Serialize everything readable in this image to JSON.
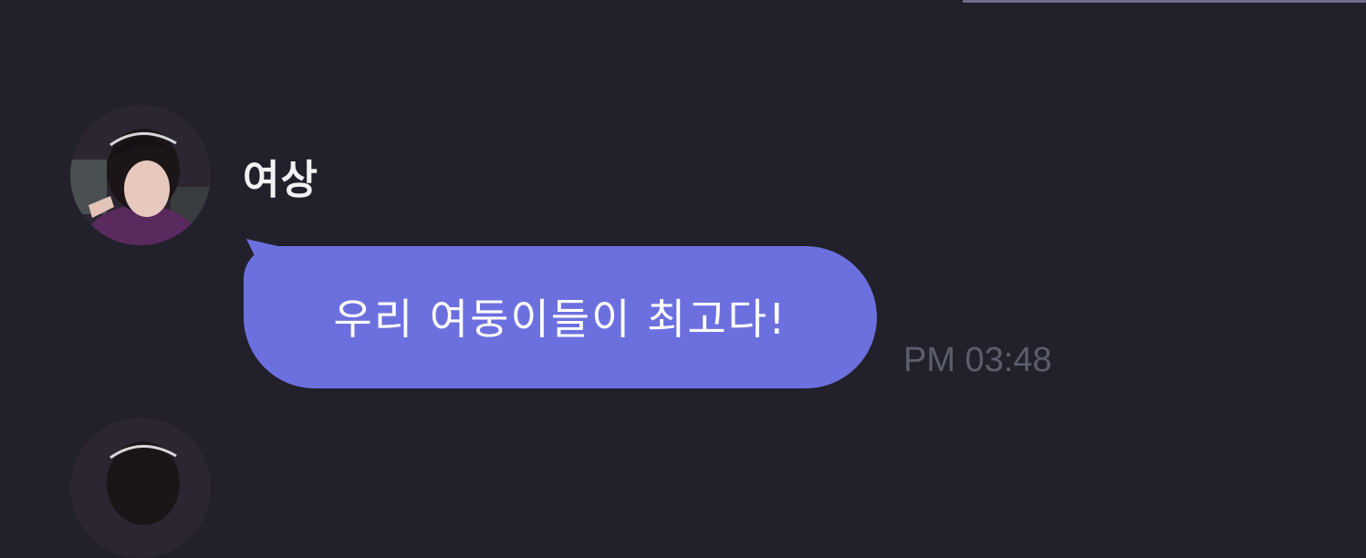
{
  "chat": {
    "message": {
      "sender": "여상",
      "text": "우리 여둥이들이 최고다!",
      "time": "PM 03:48"
    }
  },
  "colors": {
    "background": "#22212b",
    "bubble": "#6c70df",
    "bubble_text": "#ffffff",
    "sender_name": "#f2f2f5",
    "timestamp": "#5d5c6c"
  },
  "icons": {
    "avatar": "profile-avatar",
    "next_avatar": "profile-avatar-partial"
  }
}
